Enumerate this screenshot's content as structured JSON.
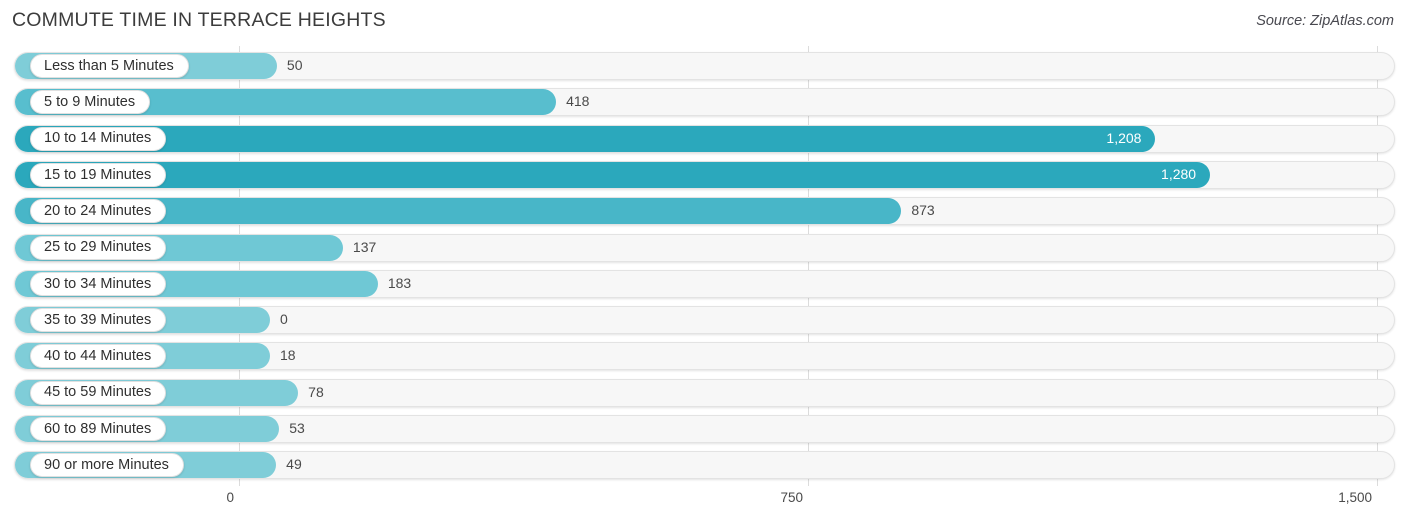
{
  "header": {
    "title": "COMMUTE TIME IN TERRACE HEIGHTS",
    "source": "Source: ZipAtlas.com"
  },
  "colors": {
    "bar_light": "#7FCDD8",
    "bar_mid": "#58BECE",
    "bar_dark": "#2BA8BC",
    "track_fill": "#F7F7F7",
    "track_border": "#E3E3E3",
    "gridline": "#DCDCDC",
    "text": "#4A4A4A",
    "value_inside": "#FFFFFF"
  },
  "chart_data": {
    "type": "bar",
    "orientation": "horizontal",
    "title": "COMMUTE TIME IN TERRACE HEIGHTS",
    "xlabel": "",
    "ylabel": "",
    "xlim": [
      0,
      1500
    ],
    "ticks": [
      "0",
      "750",
      "1,500"
    ],
    "tick_values": [
      0,
      750,
      1500
    ],
    "grid": true,
    "legend": false,
    "categories": [
      "Less than 5 Minutes",
      "5 to 9 Minutes",
      "10 to 14 Minutes",
      "15 to 19 Minutes",
      "20 to 24 Minutes",
      "25 to 29 Minutes",
      "30 to 34 Minutes",
      "35 to 39 Minutes",
      "40 to 44 Minutes",
      "45 to 59 Minutes",
      "60 to 89 Minutes",
      "90 or more Minutes"
    ],
    "values": [
      50,
      418,
      1208,
      1280,
      873,
      137,
      183,
      0,
      18,
      78,
      53,
      49
    ],
    "value_labels": [
      "50",
      "418",
      "1,208",
      "1,280",
      "873",
      "137",
      "183",
      "0",
      "18",
      "78",
      "53",
      "49"
    ]
  },
  "rows": [
    {
      "label": "Less than 5 Minutes",
      "value": 50,
      "value_label": "50",
      "color": "#7FCDD8",
      "inside": false
    },
    {
      "label": "5 to 9 Minutes",
      "value": 418,
      "value_label": "418",
      "color": "#58BECE",
      "inside": false
    },
    {
      "label": "10 to 14 Minutes",
      "value": 1208,
      "value_label": "1,208",
      "color": "#2BA8BC",
      "inside": true
    },
    {
      "label": "15 to 19 Minutes",
      "value": 1280,
      "value_label": "1,280",
      "color": "#2BA8BC",
      "inside": true
    },
    {
      "label": "20 to 24 Minutes",
      "value": 873,
      "value_label": "873",
      "color": "#48B6C8",
      "inside": false
    },
    {
      "label": "25 to 29 Minutes",
      "value": 137,
      "value_label": "137",
      "color": "#6FC8D5",
      "inside": false
    },
    {
      "label": "30 to 34 Minutes",
      "value": 183,
      "value_label": "183",
      "color": "#6FC8D5",
      "inside": false
    },
    {
      "label": "35 to 39 Minutes",
      "value": 0,
      "value_label": "0",
      "color": "#7FCDD8",
      "inside": false
    },
    {
      "label": "40 to 44 Minutes",
      "value": 18,
      "value_label": "18",
      "color": "#7FCDD8",
      "inside": false
    },
    {
      "label": "45 to 59 Minutes",
      "value": 78,
      "value_label": "78",
      "color": "#7FCDD8",
      "inside": false
    },
    {
      "label": "60 to 89 Minutes",
      "value": 53,
      "value_label": "53",
      "color": "#7FCDD8",
      "inside": false
    },
    {
      "label": "90 or more Minutes",
      "value": 49,
      "value_label": "49",
      "color": "#7FCDD8",
      "inside": false
    }
  ]
}
